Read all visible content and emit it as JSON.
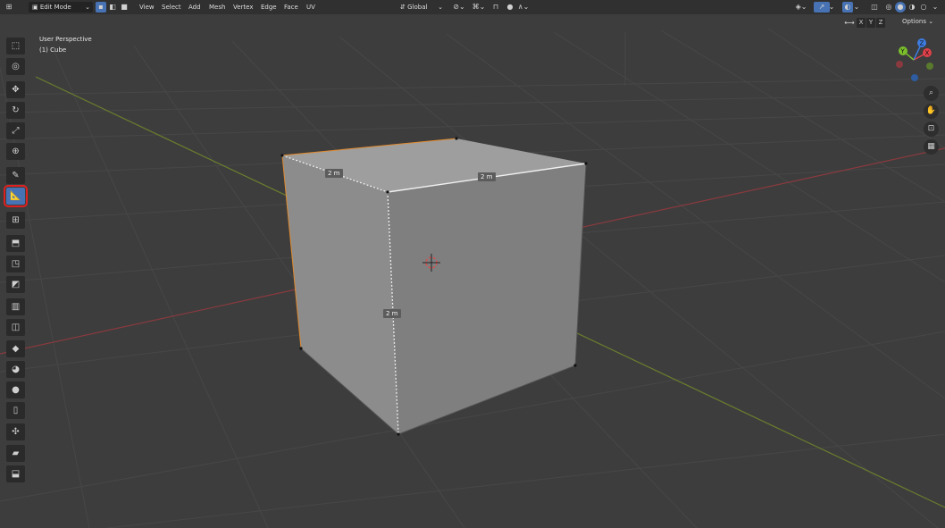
{
  "header": {
    "mode": "Edit Mode",
    "menu": [
      "View",
      "Select",
      "Add",
      "Mesh",
      "Vertex",
      "Edge",
      "Face",
      "UV"
    ],
    "orientation": "Global",
    "axis_labels": [
      "X",
      "Y",
      "Z"
    ],
    "options_label": "Options"
  },
  "viewport": {
    "view_name": "User Perspective",
    "object_name": "(1) Cube",
    "dimensions": [
      "2 m",
      "2 m",
      "2 m"
    ]
  },
  "toolbar": {
    "tools": [
      "select-box",
      "cursor",
      "move",
      "rotate",
      "scale",
      "transform",
      "annotate",
      "measure",
      "add-cube",
      "extrude-region",
      "inset-faces",
      "bevel",
      "loop-cut",
      "knife",
      "poly-build",
      "spin",
      "smooth",
      "edge-slide",
      "shrink-fatten",
      "shear",
      "rip-region"
    ],
    "active_tool": "measure"
  },
  "gizmo": {
    "axes": [
      "X",
      "Y",
      "Z"
    ],
    "colors": {
      "x": "#e0404a",
      "y": "#7bbf2c",
      "z": "#3d7ce0"
    }
  },
  "colors": {
    "background": "#3d3d3d",
    "header": "#303030",
    "accent": "#4772b3",
    "highlight": "#e02020"
  }
}
